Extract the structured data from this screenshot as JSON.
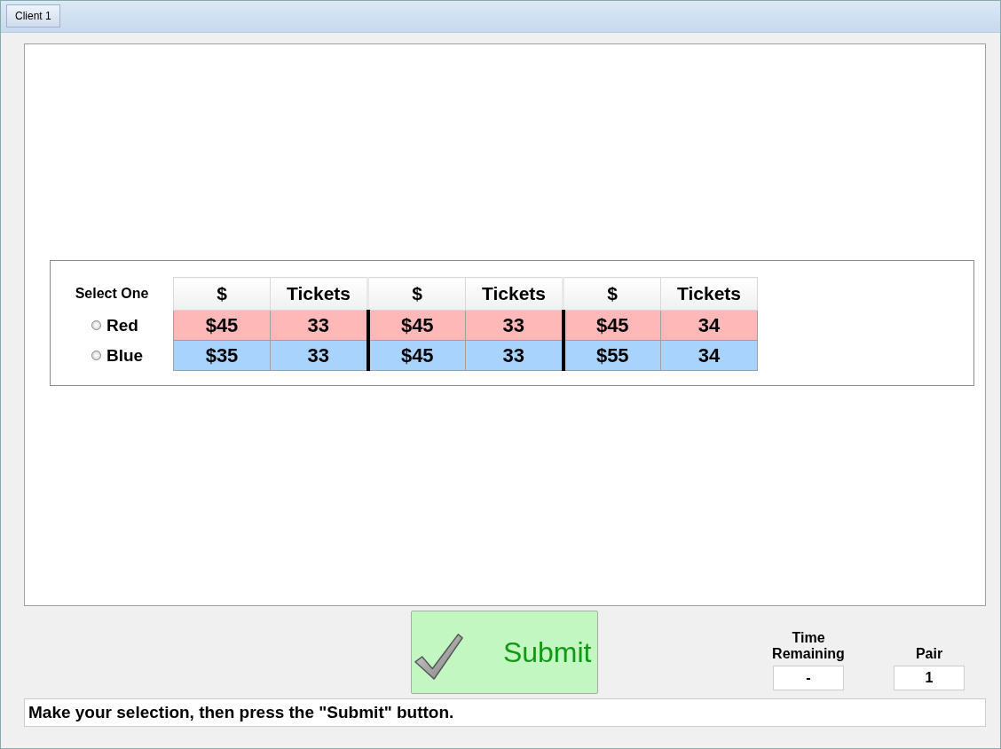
{
  "window": {
    "title": "Client 1"
  },
  "choice": {
    "prompt": "Select One",
    "headers": [
      "$",
      "Tickets",
      "$",
      "Tickets",
      "$",
      "Tickets"
    ],
    "options": [
      {
        "label": "Red",
        "selected": false,
        "color": "#ffb8b8",
        "cells": [
          "$45",
          "33",
          "$45",
          "33",
          "$45",
          "34"
        ]
      },
      {
        "label": "Blue",
        "selected": false,
        "color": "#a8d3fd",
        "cells": [
          "$35",
          "33",
          "$45",
          "33",
          "$55",
          "34"
        ]
      }
    ]
  },
  "submit": {
    "label": "Submit"
  },
  "time_remaining": {
    "label": "Time Remaining",
    "value": "-"
  },
  "pair": {
    "label": "Pair",
    "value": "1"
  },
  "status": "Make your selection, then press the \"Submit\" button."
}
